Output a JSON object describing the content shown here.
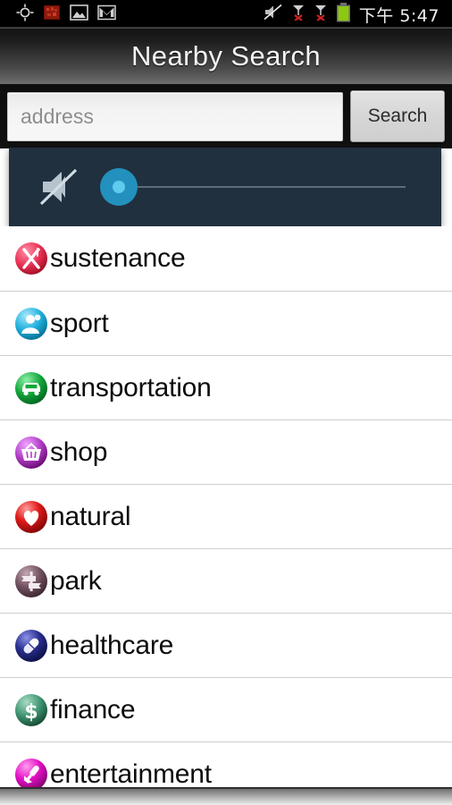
{
  "statusbar": {
    "left_icons": [
      {
        "name": "gps-location-icon",
        "glyph": "crosshair"
      },
      {
        "name": "app-notification-icon",
        "glyph": "red-square"
      },
      {
        "name": "gallery-image-icon",
        "glyph": "picture"
      },
      {
        "name": "gmail-icon",
        "glyph": "envelope-m"
      }
    ],
    "right_icons": [
      {
        "name": "volume-mute-icon",
        "glyph": "speaker-muted"
      },
      {
        "name": "sim1-no-service-icon",
        "glyph": "signal-x"
      },
      {
        "name": "sim2-no-service-icon",
        "glyph": "signal-x"
      },
      {
        "name": "battery-icon",
        "glyph": "battery-full"
      }
    ],
    "time": "下午 5:47",
    "battery_color": "#8cc814"
  },
  "titlebar": {
    "title": "Nearby Search"
  },
  "search": {
    "placeholder": "address",
    "value": "",
    "button_label": "Search"
  },
  "volume_overlay": {
    "icon_name": "speaker-muted-icon",
    "slider_value": 0,
    "slider_min": 0,
    "slider_max": 100,
    "panel_color": "#20303e",
    "thumb_color": "#2291bd",
    "track_color": "#5d6c78"
  },
  "categories": [
    {
      "label": "sustenance",
      "icon": "fork-knife-icon",
      "color": "#e8355a"
    },
    {
      "label": "sport",
      "icon": "person-icon",
      "color": "#27b6e0"
    },
    {
      "label": "transportation",
      "icon": "car-icon",
      "color": "#16a93e"
    },
    {
      "label": "shop",
      "icon": "shopping-basket-icon",
      "color": "#b23ec8"
    },
    {
      "label": "natural",
      "icon": "heart-icon",
      "color": "#e01b1b"
    },
    {
      "label": "park",
      "icon": "signpost-icon",
      "color": "#6f4f5e"
    },
    {
      "label": "healthcare",
      "icon": "pill-icon",
      "color": "#2a2f8f"
    },
    {
      "label": "finance",
      "icon": "dollar-icon",
      "color": "#3f9472"
    },
    {
      "label": "entertainment",
      "icon": "microphone-icon",
      "color": "#e310c4"
    }
  ]
}
